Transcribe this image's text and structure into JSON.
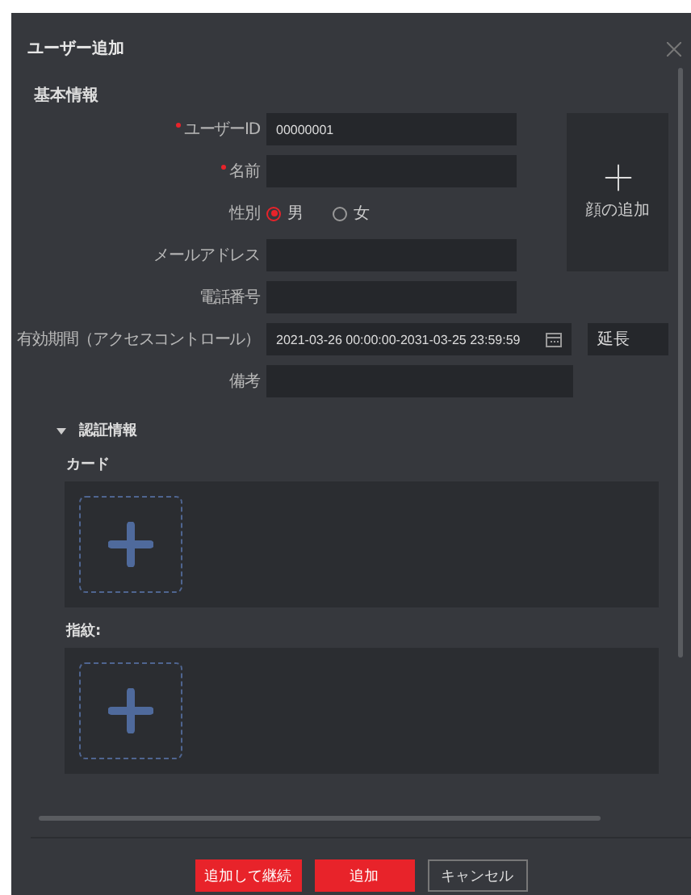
{
  "window": {
    "title": "ユーザー追加"
  },
  "basic": {
    "heading": "基本情報",
    "fields": [
      {
        "kind": "text",
        "label": "ユーザーID",
        "required": true,
        "value": "00000001"
      },
      {
        "kind": "text",
        "label": "名前",
        "required": true
      },
      {
        "kind": "radio",
        "label": "性別",
        "options": [
          {
            "label": "男",
            "selected": true
          },
          {
            "label": "女",
            "selected": false
          }
        ]
      },
      {
        "kind": "text",
        "label": "メールアドレス",
        "required": false
      },
      {
        "kind": "text",
        "label": "電話番号",
        "required": false
      },
      {
        "kind": "date",
        "label": "有効期間（アクセスコントロール）",
        "value": "2021-03-26 00:00:00-2031-03-25 23:59:59",
        "action": "延長"
      },
      {
        "kind": "wide",
        "label": "備考"
      }
    ],
    "photo": {
      "label": "顔の追加"
    }
  },
  "auth": {
    "heading": "認証情報",
    "expanded": true,
    "groups": [
      {
        "title": "カード"
      },
      {
        "title": "指紋:"
      }
    ]
  },
  "buttons": [
    {
      "label": "追加して継続",
      "kind": "primary"
    },
    {
      "label": "追加",
      "kind": "primary"
    },
    {
      "label": "キャンセル",
      "kind": "secondary"
    }
  ]
}
